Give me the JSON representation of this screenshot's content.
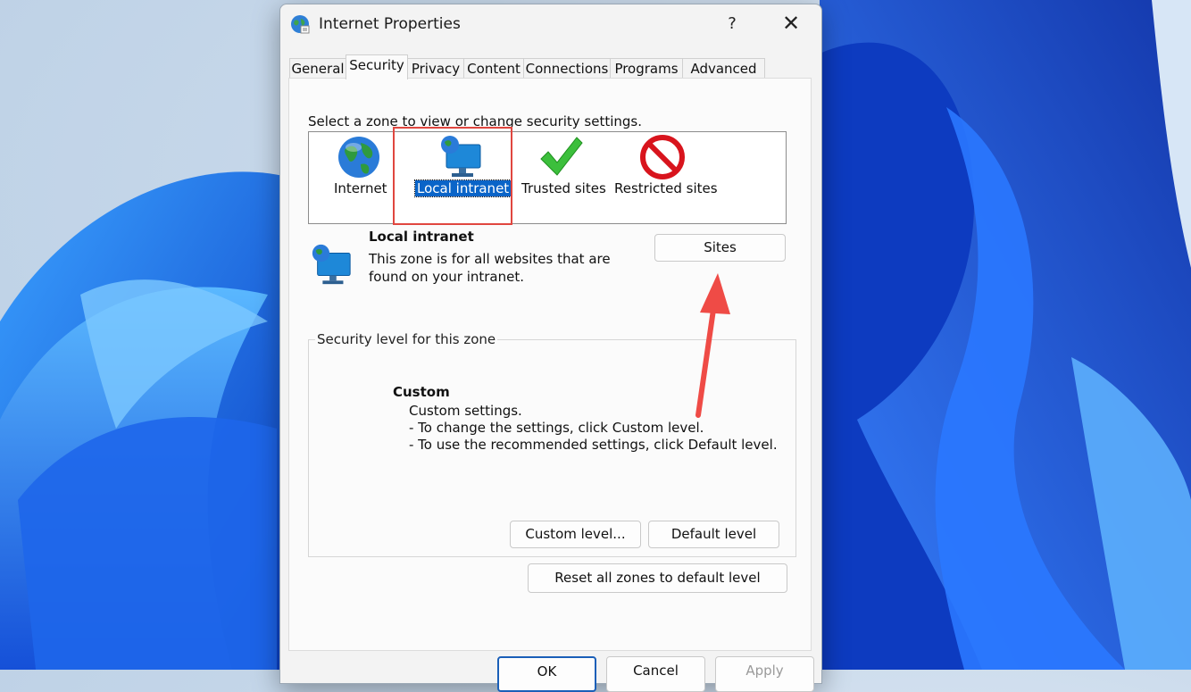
{
  "dialog": {
    "title": "Internet Properties",
    "help": "?",
    "close": "✕"
  },
  "tabs": [
    "General",
    "Security",
    "Privacy",
    "Content",
    "Connections",
    "Programs",
    "Advanced"
  ],
  "active_tab": "Security",
  "security": {
    "zone_prompt": "Select a zone to view or change security settings.",
    "zones": [
      {
        "label": "Internet",
        "icon": "globe-icon"
      },
      {
        "label": "Local intranet",
        "icon": "intranet-icon",
        "selected": true
      },
      {
        "label": "Trusted sites",
        "icon": "checkmark-icon"
      },
      {
        "label": "Restricted sites",
        "icon": "restricted-icon"
      }
    ],
    "zone_title": "Local intranet",
    "zone_desc_1": "This zone is for all websites that are",
    "zone_desc_2": "found on your intranet.",
    "sites_button": "Sites",
    "level_group_label": "Security level for this zone",
    "level_name": "Custom",
    "level_desc_1": "Custom settings.",
    "level_desc_2": "- To change the settings, click Custom level.",
    "level_desc_3": "- To use the recommended settings, click Default level.",
    "custom_level_button": "Custom level...",
    "default_level_button": "Default level",
    "reset_button": "Reset all zones to default level"
  },
  "footer": {
    "ok": "OK",
    "cancel": "Cancel",
    "apply": "Apply"
  },
  "colors": {
    "selection": "#0a64c8",
    "highlight_box": "#e0463f",
    "arrow": "#ef4b46",
    "wallpaper_blue": "#1a5fe0"
  }
}
